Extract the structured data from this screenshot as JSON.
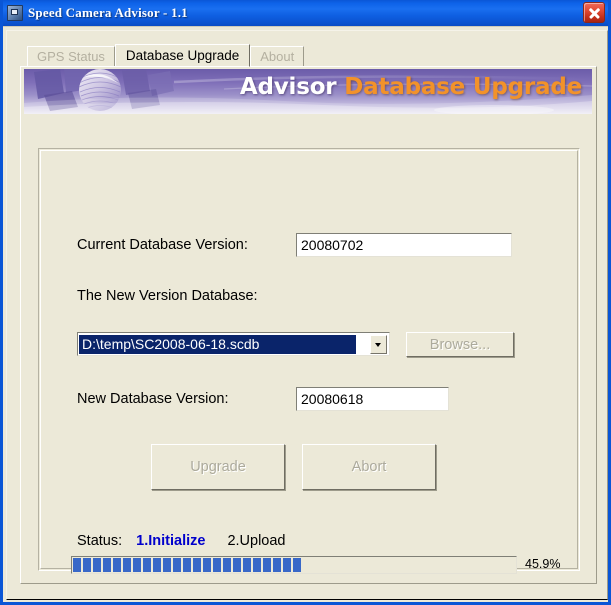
{
  "window": {
    "title": "Speed Camera Advisor - 1.1",
    "icon": "app-icon",
    "close_label": "×"
  },
  "tabs": [
    {
      "label": "GPS Status",
      "active": false,
      "enabled": false
    },
    {
      "label": "Database Upgrade",
      "active": true,
      "enabled": true
    },
    {
      "label": "About",
      "active": false,
      "enabled": false
    }
  ],
  "banner": {
    "word_white": "Advisor",
    "word_orange": "Database Upgrade",
    "bg_color": "#8a7cbd",
    "white_color": "#ffffff",
    "orange_color": "#f2922a"
  },
  "form": {
    "current_version_label": "Current Database Version:",
    "current_version_value": "20080702",
    "new_version_db_label": "The New Version Database:",
    "database_path_value": "D:\\temp\\SC2008-06-18.scdb",
    "browse_label": "Browse...",
    "new_version_label": "New Database Version:",
    "new_version_value": "20080618",
    "upgrade_label": "Upgrade",
    "abort_label": "Abort"
  },
  "status": {
    "label": "Status:",
    "step_active": "1.Initialize",
    "step_next": "2.Upload",
    "active_color": "#0000cc"
  },
  "progress": {
    "percent_text": "45.9%",
    "percent_value": 45.9,
    "segments": 23,
    "bar_color": "#3868c8"
  }
}
